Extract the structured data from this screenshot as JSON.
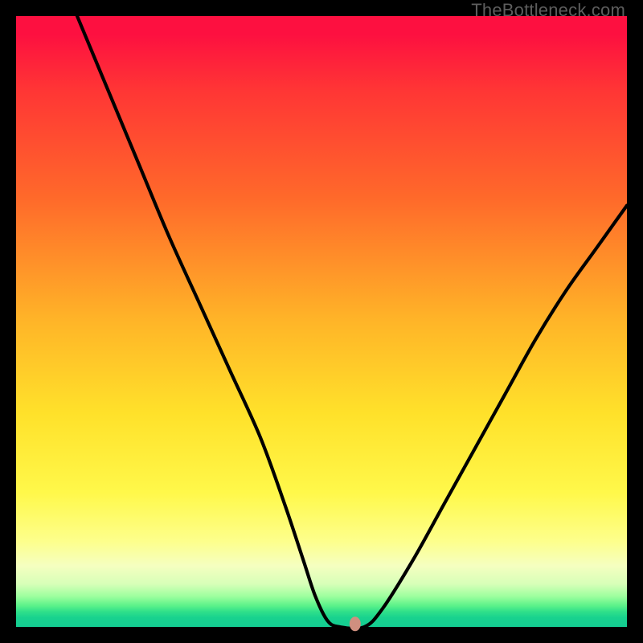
{
  "watermark": "TheBottleneck.com",
  "chart_data": {
    "type": "line",
    "title": "",
    "xlabel": "",
    "ylabel": "",
    "xlim": [
      0,
      100
    ],
    "ylim": [
      0,
      100
    ],
    "series": [
      {
        "name": "curve",
        "x": [
          10,
          15,
          20,
          25,
          30,
          35,
          40,
          44,
          47,
          49,
          51,
          53,
          57,
          60,
          65,
          70,
          75,
          80,
          85,
          90,
          95,
          100
        ],
        "y": [
          100,
          88,
          76,
          64,
          53,
          42,
          31,
          20,
          11,
          5,
          1,
          0,
          0,
          3,
          11,
          20,
          29,
          38,
          47,
          55,
          62,
          69
        ]
      }
    ],
    "marker": {
      "x": 55.5,
      "y": 0.5,
      "color": "#cf8f7f",
      "rx": 7,
      "ry": 9
    },
    "gradient_stops": [
      {
        "pct": 0,
        "color": "#fd1040"
      },
      {
        "pct": 12,
        "color": "#ff3535"
      },
      {
        "pct": 30,
        "color": "#ff6a2a"
      },
      {
        "pct": 50,
        "color": "#ffb528"
      },
      {
        "pct": 65,
        "color": "#ffe12a"
      },
      {
        "pct": 78,
        "color": "#fff84a"
      },
      {
        "pct": 86,
        "color": "#fdff8c"
      },
      {
        "pct": 90,
        "color": "#f5ffc0"
      },
      {
        "pct": 93,
        "color": "#d7ffb8"
      },
      {
        "pct": 95,
        "color": "#9dff9e"
      },
      {
        "pct": 97,
        "color": "#5cf28a"
      },
      {
        "pct": 100,
        "color": "#14cc92"
      }
    ]
  }
}
